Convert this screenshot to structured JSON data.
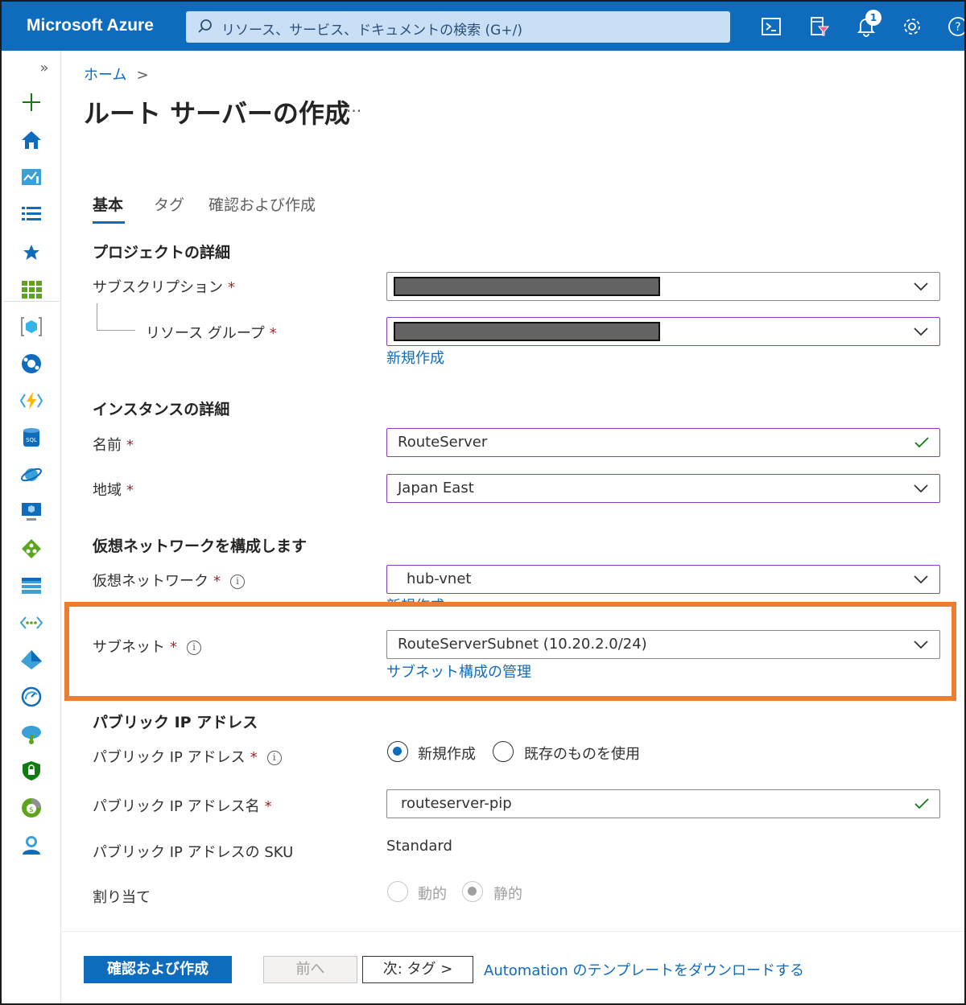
{
  "header": {
    "brand": "Microsoft Azure",
    "search_placeholder": "リソース、サービス、ドキュメントの検索 (G+/)",
    "notification_count": "1",
    "icons": [
      "cloud-shell-icon",
      "directory-filter-icon",
      "notifications-icon",
      "settings-icon",
      "help-icon"
    ]
  },
  "sidebar": {
    "expand": "»",
    "items": [
      "create-resource-icon",
      "home-icon",
      "dashboard-icon",
      "all-services-icon",
      "favorites-icon",
      "all-resources-icon",
      "resource-groups-icon",
      "app-services-icon",
      "function-app-icon",
      "sql-database-icon",
      "cosmos-db-icon",
      "virtual-machine-icon",
      "load-balancer-icon",
      "storage-account-icon",
      "virtual-network-icon",
      "entra-id-icon",
      "monitor-icon",
      "advisor-icon",
      "defender-icon",
      "cost-management-icon",
      "help-support-icon"
    ]
  },
  "breadcrumb": {
    "home": "ホーム",
    "sep": ">"
  },
  "page": {
    "title": "ルート サーバーの作成",
    "more": "···"
  },
  "tabs": [
    {
      "label": "基本",
      "active": true
    },
    {
      "label": "タグ",
      "active": false
    },
    {
      "label": "確認および作成",
      "active": false
    }
  ],
  "sections": {
    "project": "プロジェクトの詳細",
    "instance": "インスタンスの詳細",
    "vnet": "仮想ネットワークを構成します",
    "pip": "パブリック IP アドレス"
  },
  "fields": {
    "subscription": {
      "label": "サブスクリプション",
      "value": ""
    },
    "resource_group": {
      "label": "リソース グループ",
      "value": "",
      "create_new": "新規作成"
    },
    "name": {
      "label": "名前",
      "value": "RouteServer"
    },
    "region": {
      "label": "地域",
      "value": "Japan East"
    },
    "virtual_network": {
      "label": "仮想ネットワーク",
      "value": "hub-vnet",
      "create_new": "新規作成"
    },
    "subnet": {
      "label": "サブネット",
      "value": "RouteServerSubnet (10.20.2.0/24)",
      "manage": "サブネット構成の管理"
    },
    "public_ip": {
      "label": "パブリック IP アドレス",
      "options": [
        "新規作成",
        "既存のものを使用"
      ],
      "selected": "新規作成"
    },
    "public_ip_name": {
      "label": "パブリック IP アドレス名",
      "value": "routeserver-pip"
    },
    "public_ip_sku": {
      "label": "パブリック IP アドレスの SKU",
      "value": "Standard"
    },
    "assignment": {
      "label": "割り当て",
      "options": [
        "動的",
        "静的"
      ],
      "selected": "静的"
    }
  },
  "required_mark": "*",
  "info_mark": "i",
  "footer": {
    "review_create": "確認および作成",
    "previous": "前へ",
    "next": "次: タグ >",
    "download_template": "Automation のテンプレートをダウンロードする"
  },
  "colors": {
    "accent": "#0f6cbd",
    "highlight": "#ed7d31",
    "required": "#a4262c",
    "focus_border": "#8a3fb5"
  }
}
